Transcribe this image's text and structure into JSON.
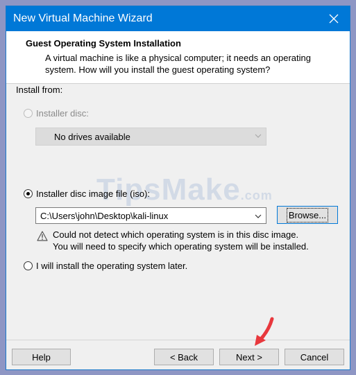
{
  "window": {
    "title": "New Virtual Machine Wizard",
    "close_icon": "close-icon"
  },
  "header": {
    "title": "Guest Operating System Installation",
    "description": "A virtual machine is like a physical computer; it needs an operating system. How will you install the guest operating system?"
  },
  "install_from": {
    "label": "Install from:",
    "installer_disc": {
      "label": "Installer disc:",
      "selected": false,
      "enabled": false,
      "dropdown_value": "No drives available"
    },
    "iso": {
      "label": "Installer disc image file (iso):",
      "selected": true,
      "path_value": "C:\\Users\\john\\Desktop\\kali-linux",
      "browse_label": "Browse...",
      "warning_line1": "Could not detect which operating system is in this disc image.",
      "warning_line2": "You will need to specify which operating system will be installed.",
      "warning_icon": "warning-icon"
    },
    "later": {
      "label": "I will install the operating system later.",
      "selected": false
    }
  },
  "watermark": {
    "main": "TipsMake",
    "suffix": ".com"
  },
  "footer": {
    "help_label": "Help",
    "back_label": "< Back",
    "next_label": "Next >",
    "cancel_label": "Cancel"
  },
  "colors": {
    "titlebar": "#0078d7",
    "background": "#f0f0f0",
    "arrow": "#e8383d",
    "outer_frame": "#8e96c4"
  }
}
